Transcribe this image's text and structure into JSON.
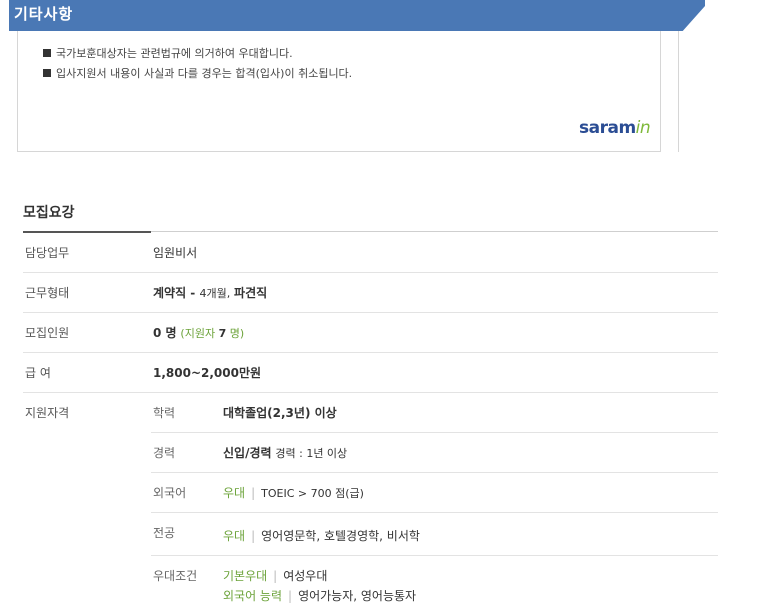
{
  "notice": {
    "title": "기타사항",
    "items": [
      "국가보훈대상자는 관련법규에 의거하여 우대합니다.",
      "입사지원서 내용이 사실과 다를 경우는 합격(입사)이 취소됩니다."
    ],
    "logo_main": "saram",
    "logo_accent": "in"
  },
  "recruit": {
    "title": "모집요강",
    "duty": {
      "label": "담당업무",
      "value": "임원비서"
    },
    "employment": {
      "label": "근무형태",
      "type": "계약직",
      "dash": " - ",
      "period": "4개월,",
      "kind": "파견직"
    },
    "headcount": {
      "label": "모집인원",
      "value": "0 명",
      "applicants_prefix": "(지원자 ",
      "applicants_num": "7",
      "applicants_suffix": " 명)"
    },
    "salary": {
      "label": "급 여",
      "value": "1,800~2,000만원"
    },
    "qualification": {
      "label": "지원자격",
      "education": {
        "label": "학력",
        "value": "대학졸업(2,3년) 이상"
      },
      "career": {
        "label": "경력",
        "value": "신입/경력",
        "note": "경력 : 1년 이상"
      },
      "language": {
        "label": "외국어",
        "tag": "우대",
        "sep": "|",
        "value": "TOEIC > 700 점(급)"
      },
      "major": {
        "label": "전공",
        "tag": "우대",
        "sep": "|",
        "value": "영어영문학, 호텔경영학, 비서학"
      },
      "preference": {
        "label": "우대조건",
        "basic_tag": "기본우대",
        "basic_sep": "|",
        "basic_value": "여성우대",
        "lang_tag": "외국어 능력",
        "lang_sep": "|",
        "lang_value": "영어가능자, 영어능통자"
      }
    }
  }
}
